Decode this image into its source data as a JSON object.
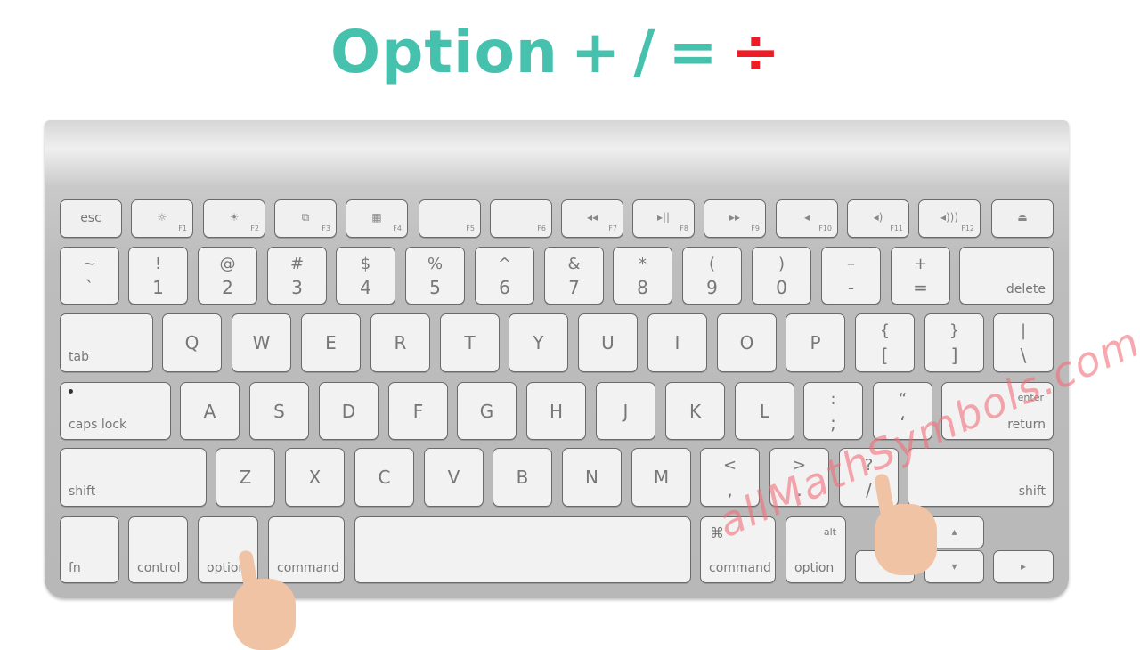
{
  "title": {
    "left": "Option",
    "plus": "+",
    "slash": "/",
    "equals": "=",
    "result": "÷"
  },
  "colors": {
    "title": "#45c1ae",
    "result": "#ee1c24",
    "watermark": "#f06e78"
  },
  "watermark": "allMathSymbols.com",
  "keyboard": {
    "function_row": [
      {
        "main": "esc"
      },
      {
        "icon": "☼",
        "fnum": "F1"
      },
      {
        "icon": "☀",
        "fnum": "F2"
      },
      {
        "icon": "⧉",
        "fnum": "F3"
      },
      {
        "icon": "▦",
        "fnum": "F4"
      },
      {
        "fnum": "F5"
      },
      {
        "fnum": "F6"
      },
      {
        "icon": "◂◂",
        "fnum": "F7"
      },
      {
        "icon": "▸||",
        "fnum": "F8"
      },
      {
        "icon": "▸▸",
        "fnum": "F9"
      },
      {
        "icon": "◂",
        "fnum": "F10"
      },
      {
        "icon": "◂)",
        "fnum": "F11"
      },
      {
        "icon": "◂)))",
        "fnum": "F12"
      },
      {
        "icon": "⏏"
      }
    ],
    "number_row": [
      {
        "top": "~",
        "bot": "`"
      },
      {
        "top": "!",
        "bot": "1"
      },
      {
        "top": "@",
        "bot": "2"
      },
      {
        "top": "#",
        "bot": "3"
      },
      {
        "top": "$",
        "bot": "4"
      },
      {
        "top": "%",
        "bot": "5"
      },
      {
        "top": "^",
        "bot": "6"
      },
      {
        "top": "&",
        "bot": "7"
      },
      {
        "top": "*",
        "bot": "8"
      },
      {
        "top": "(",
        "bot": "9"
      },
      {
        "top": ")",
        "bot": "0"
      },
      {
        "top": "–",
        "bot": "-"
      },
      {
        "top": "+",
        "bot": "="
      },
      {
        "lblr": "delete"
      }
    ],
    "qwerty_row": [
      {
        "lbl": "tab"
      },
      {
        "main": "Q"
      },
      {
        "main": "W"
      },
      {
        "main": "E"
      },
      {
        "main": "R"
      },
      {
        "main": "T"
      },
      {
        "main": "Y"
      },
      {
        "main": "U"
      },
      {
        "main": "I"
      },
      {
        "main": "O"
      },
      {
        "main": "P"
      },
      {
        "top": "{",
        "bot": "["
      },
      {
        "top": "}",
        "bot": "]"
      },
      {
        "top": "|",
        "bot": "\\"
      }
    ],
    "home_row": [
      {
        "lbl": "caps lock"
      },
      {
        "main": "A"
      },
      {
        "main": "S"
      },
      {
        "main": "D"
      },
      {
        "main": "F"
      },
      {
        "main": "G"
      },
      {
        "main": "H"
      },
      {
        "main": "J"
      },
      {
        "main": "K"
      },
      {
        "main": "L"
      },
      {
        "top": ":",
        "bot": ";"
      },
      {
        "top": "“",
        "bot": "‘"
      },
      {
        "toplr": "enter",
        "lblr": "return"
      }
    ],
    "shift_row": [
      {
        "lbl": "shift"
      },
      {
        "main": "Z"
      },
      {
        "main": "X"
      },
      {
        "main": "C"
      },
      {
        "main": "V"
      },
      {
        "main": "B"
      },
      {
        "main": "N"
      },
      {
        "main": "M"
      },
      {
        "top": "<",
        "bot": ","
      },
      {
        "top": ">",
        "bot": "."
      },
      {
        "top": "?",
        "bot": "/"
      },
      {
        "lblr": "shift"
      }
    ],
    "bottom_row": [
      {
        "lbl": "fn"
      },
      {
        "lbl": "control"
      },
      {
        "lbl": "option"
      },
      {
        "lbl": "command"
      },
      {},
      {
        "topll": "⌘",
        "lbl": "command"
      },
      {
        "toplr": "alt",
        "lbl": "option"
      },
      {
        "icon": "◂"
      },
      {
        "icon": "▴"
      },
      {
        "icon": "▾"
      },
      {
        "icon": "▸"
      }
    ]
  }
}
